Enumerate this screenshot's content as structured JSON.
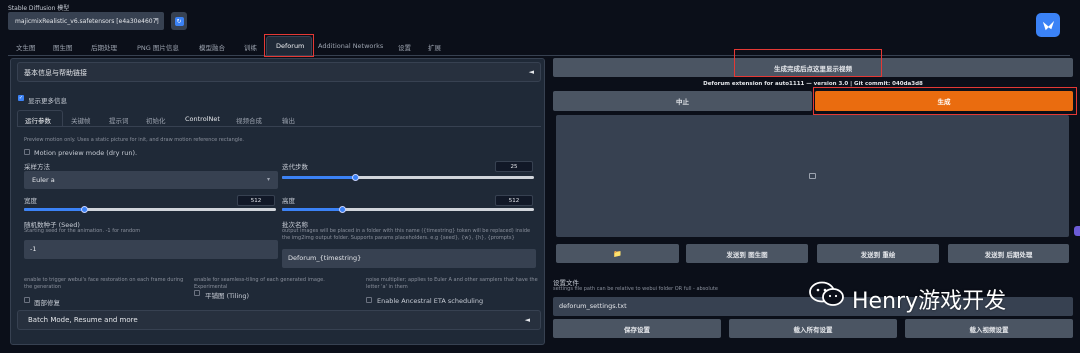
{
  "model": {
    "label": "Stable Diffusion 模型",
    "value": "majicmixRealistic_v6.safetensors [e4a30e4607]",
    "refresh_icon": "refresh-icon"
  },
  "top_tabs": [
    "文生图",
    "图生图",
    "后期处理",
    "PNG 图片信息",
    "模型融合",
    "训练",
    "Deforum",
    "Additional Networks",
    "设置",
    "扩展"
  ],
  "accordion_basic": {
    "title": "基本信息与帮助链接",
    "toggle": "◄"
  },
  "show_more": "显示更多信息",
  "sub_tabs": [
    "运行参数",
    "关键帧",
    "提示词",
    "初始化",
    "ControlNet",
    "视频合成",
    "输出"
  ],
  "preview_note": "Preview motion only. Uses a static picture for init, and draw motion reference rectangle.",
  "motion_preview": "Motion preview mode (dry run).",
  "sampler": {
    "label": "采样方法",
    "value": "Euler a"
  },
  "steps": {
    "label": "迭代步数",
    "value": "25",
    "fraction": 0.29
  },
  "width": {
    "label": "宽度",
    "value": "512",
    "fraction": 0.24
  },
  "height": {
    "label": "高度",
    "value": "512",
    "fraction": 0.24
  },
  "seed": {
    "label": "随机数种子 (Seed)",
    "desc": "Starting seed for the animation. -1 for random",
    "value": "-1"
  },
  "batch_name": {
    "label": "批次名称",
    "desc": "output images will be placed in a folder with this name ({timestring} token will be replaced) inside the img2img output folder. Supports params placeholders. e.g {seed}, {w}, {h}, {prompts}",
    "value": "Deforum_{timestring}"
  },
  "face_restore": {
    "desc": "enable to trigger webui's face restoration on each frame during the generation",
    "label": "面部修复"
  },
  "tiling": {
    "desc": "enable for seamless-tiling of each generated image. Experimental",
    "label": "平铺图 (Tiling)"
  },
  "eta": {
    "desc": "noise multiplier; applies to Euler A and other samplers that have the letter 'a' in them",
    "label": "Enable Ancestral ETA scheduling"
  },
  "batch_mode": {
    "title": "Batch Mode, Resume and more",
    "toggle": "◄"
  },
  "right": {
    "show_video_button": "生成完成后点这里显示视频",
    "extension_info": "Deforum extension for auto1111 — version 3.0 | Git commit: 040da3d8",
    "interrupt_button": "中止",
    "generate_button": "生成",
    "folder_button": "📁",
    "send_img2img": "发送到 图生图",
    "send_inpaint": "发送到 重绘",
    "send_extras": "发送到 后期处理",
    "settings_file_label": "设置文件",
    "settings_file_desc": "settings file path can be relative to webui folder OR full - absolute",
    "settings_file_value": "deforum_settings.txt",
    "save_settings": "保存设置",
    "load_all_settings": "载入所有设置",
    "load_video_settings": "载入视频设置"
  },
  "watermark": "Henry游戏开发",
  "colors": {
    "accent_orange": "#ea6c0f",
    "annotation_red": "#e53935",
    "background": "#0b0f19"
  }
}
